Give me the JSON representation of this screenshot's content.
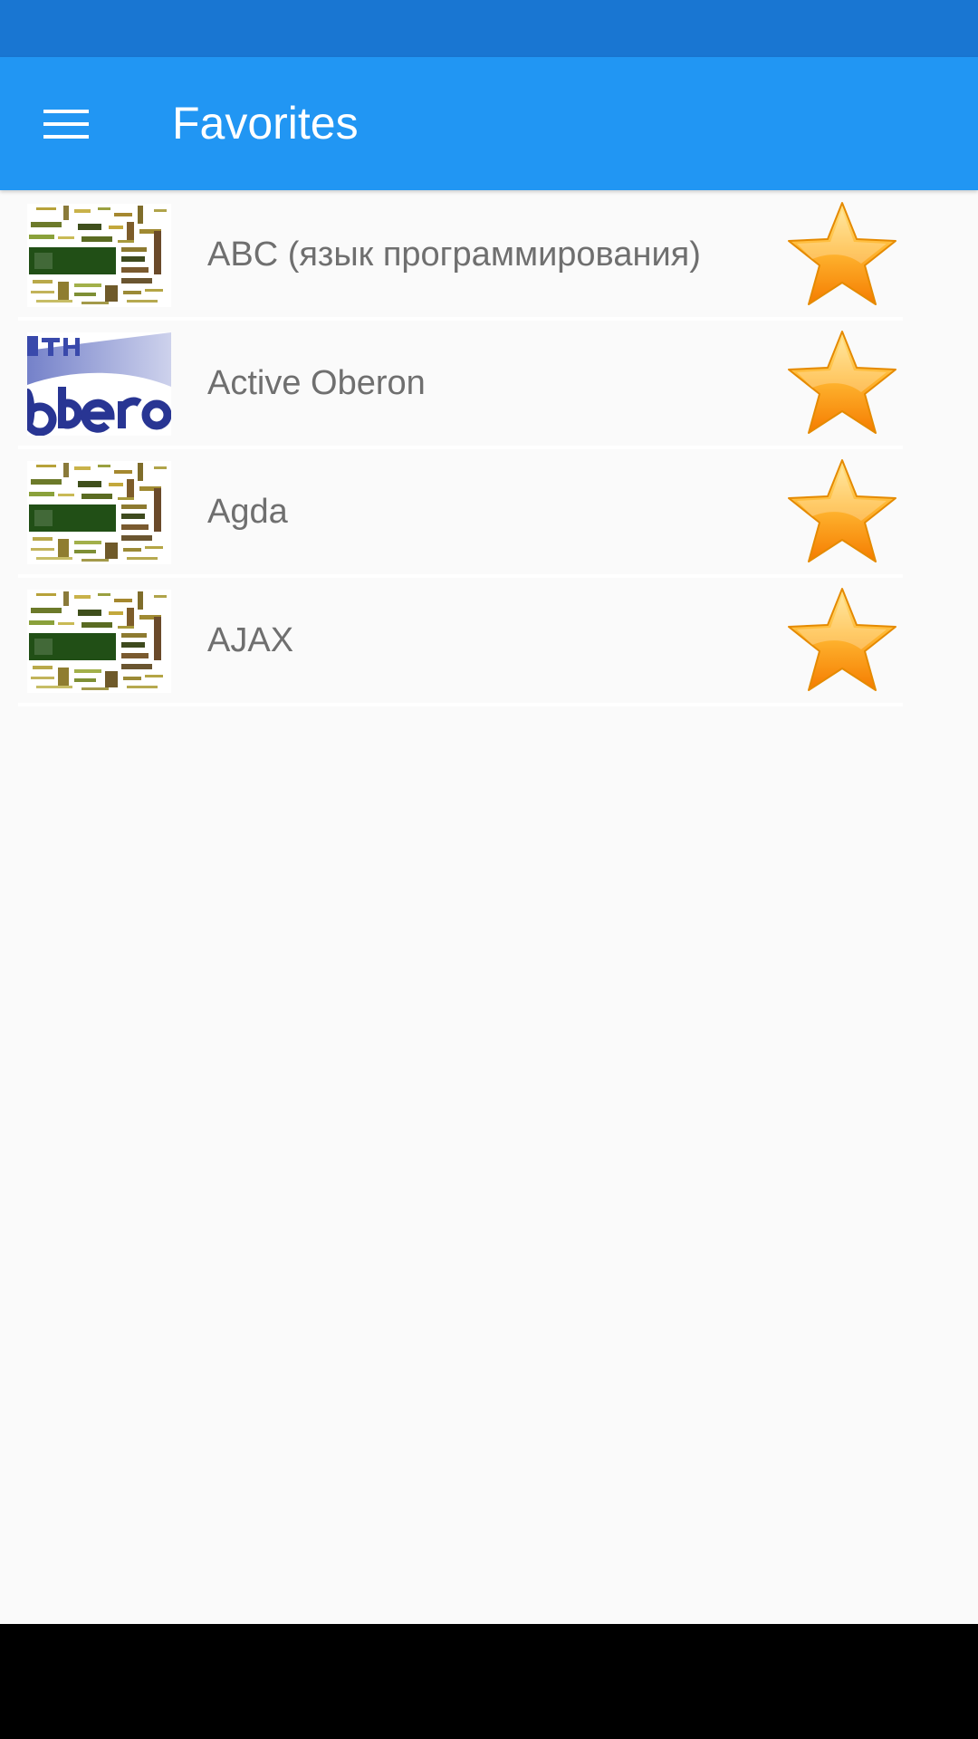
{
  "app_bar": {
    "title": "Favorites",
    "menu_icon": "hamburger-menu-icon",
    "background_color": "#2196f3",
    "status_bar_color": "#1976d2"
  },
  "favorites": {
    "items": [
      {
        "label": "ABC (язык программирования)",
        "thumbnail": "programming-languages-word-cloud",
        "favorite_icon": "star-icon"
      },
      {
        "label": "Active Oberon",
        "thumbnail": "oberon-logo",
        "favorite_icon": "star-icon"
      },
      {
        "label": "Agda",
        "thumbnail": "programming-languages-word-cloud",
        "favorite_icon": "star-icon"
      },
      {
        "label": "AJAX",
        "thumbnail": "programming-languages-word-cloud",
        "favorite_icon": "star-icon"
      }
    ]
  },
  "colors": {
    "star_fill": "#ffa726",
    "label_text": "#6f6f6f",
    "page_background": "#fafafa"
  }
}
